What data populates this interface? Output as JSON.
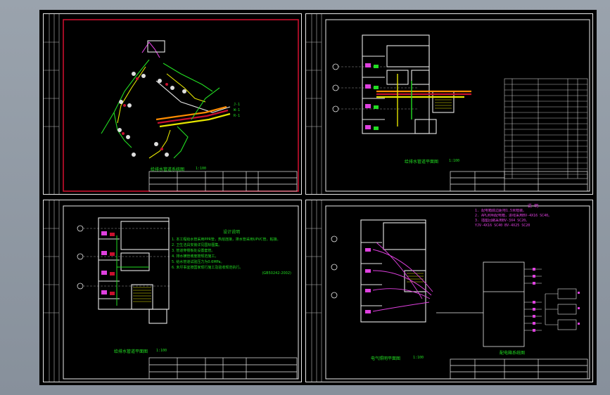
{
  "sheets": [
    {
      "title": "给排水管道系统图",
      "scale": "1:100"
    },
    {
      "title": "给排水管道平面图",
      "scale": "1:100"
    },
    {
      "title": "给排水管道平面图",
      "scale": "1:100",
      "notes_heading": "设计说明",
      "notes": [
        "1. 本工程给水管采用PPR管，热熔连接，排水管采用UPVC管，粘接。",
        "2. 卫生洁具安装详见国标图集。",
        "3. 管道穿楼板处设置套管。",
        "4. 排水横管坡度按规范施工。",
        "5. 给水管道试验压力为0.6MPa。",
        "6. 未尽事宜按国家现行施工及验收规范执行。",
        "(GB50242-2002)"
      ]
    },
    {
      "title": "电气照明平面图",
      "scale": "1:100",
      "notes_heading": "说 明",
      "system_title": "配电箱系统图",
      "notes": [
        "1. 配电箱底边距地1.5米暗装。",
        "2. APL照明配电箱，进线采用BV-4X16 SC40。",
        "3. 插座回路采用BV-3X4 SC20。",
        "YJV-4X16 SC40 BV-4X25 SC20"
      ]
    }
  ],
  "colors": {
    "frame": "#e8e8e8",
    "red_border": "#c8102e",
    "green": "#22dd22",
    "yellow": "#e6e600",
    "magenta": "#e040e0",
    "orange": "#ff8c00",
    "cyan": "#00e0e0"
  }
}
